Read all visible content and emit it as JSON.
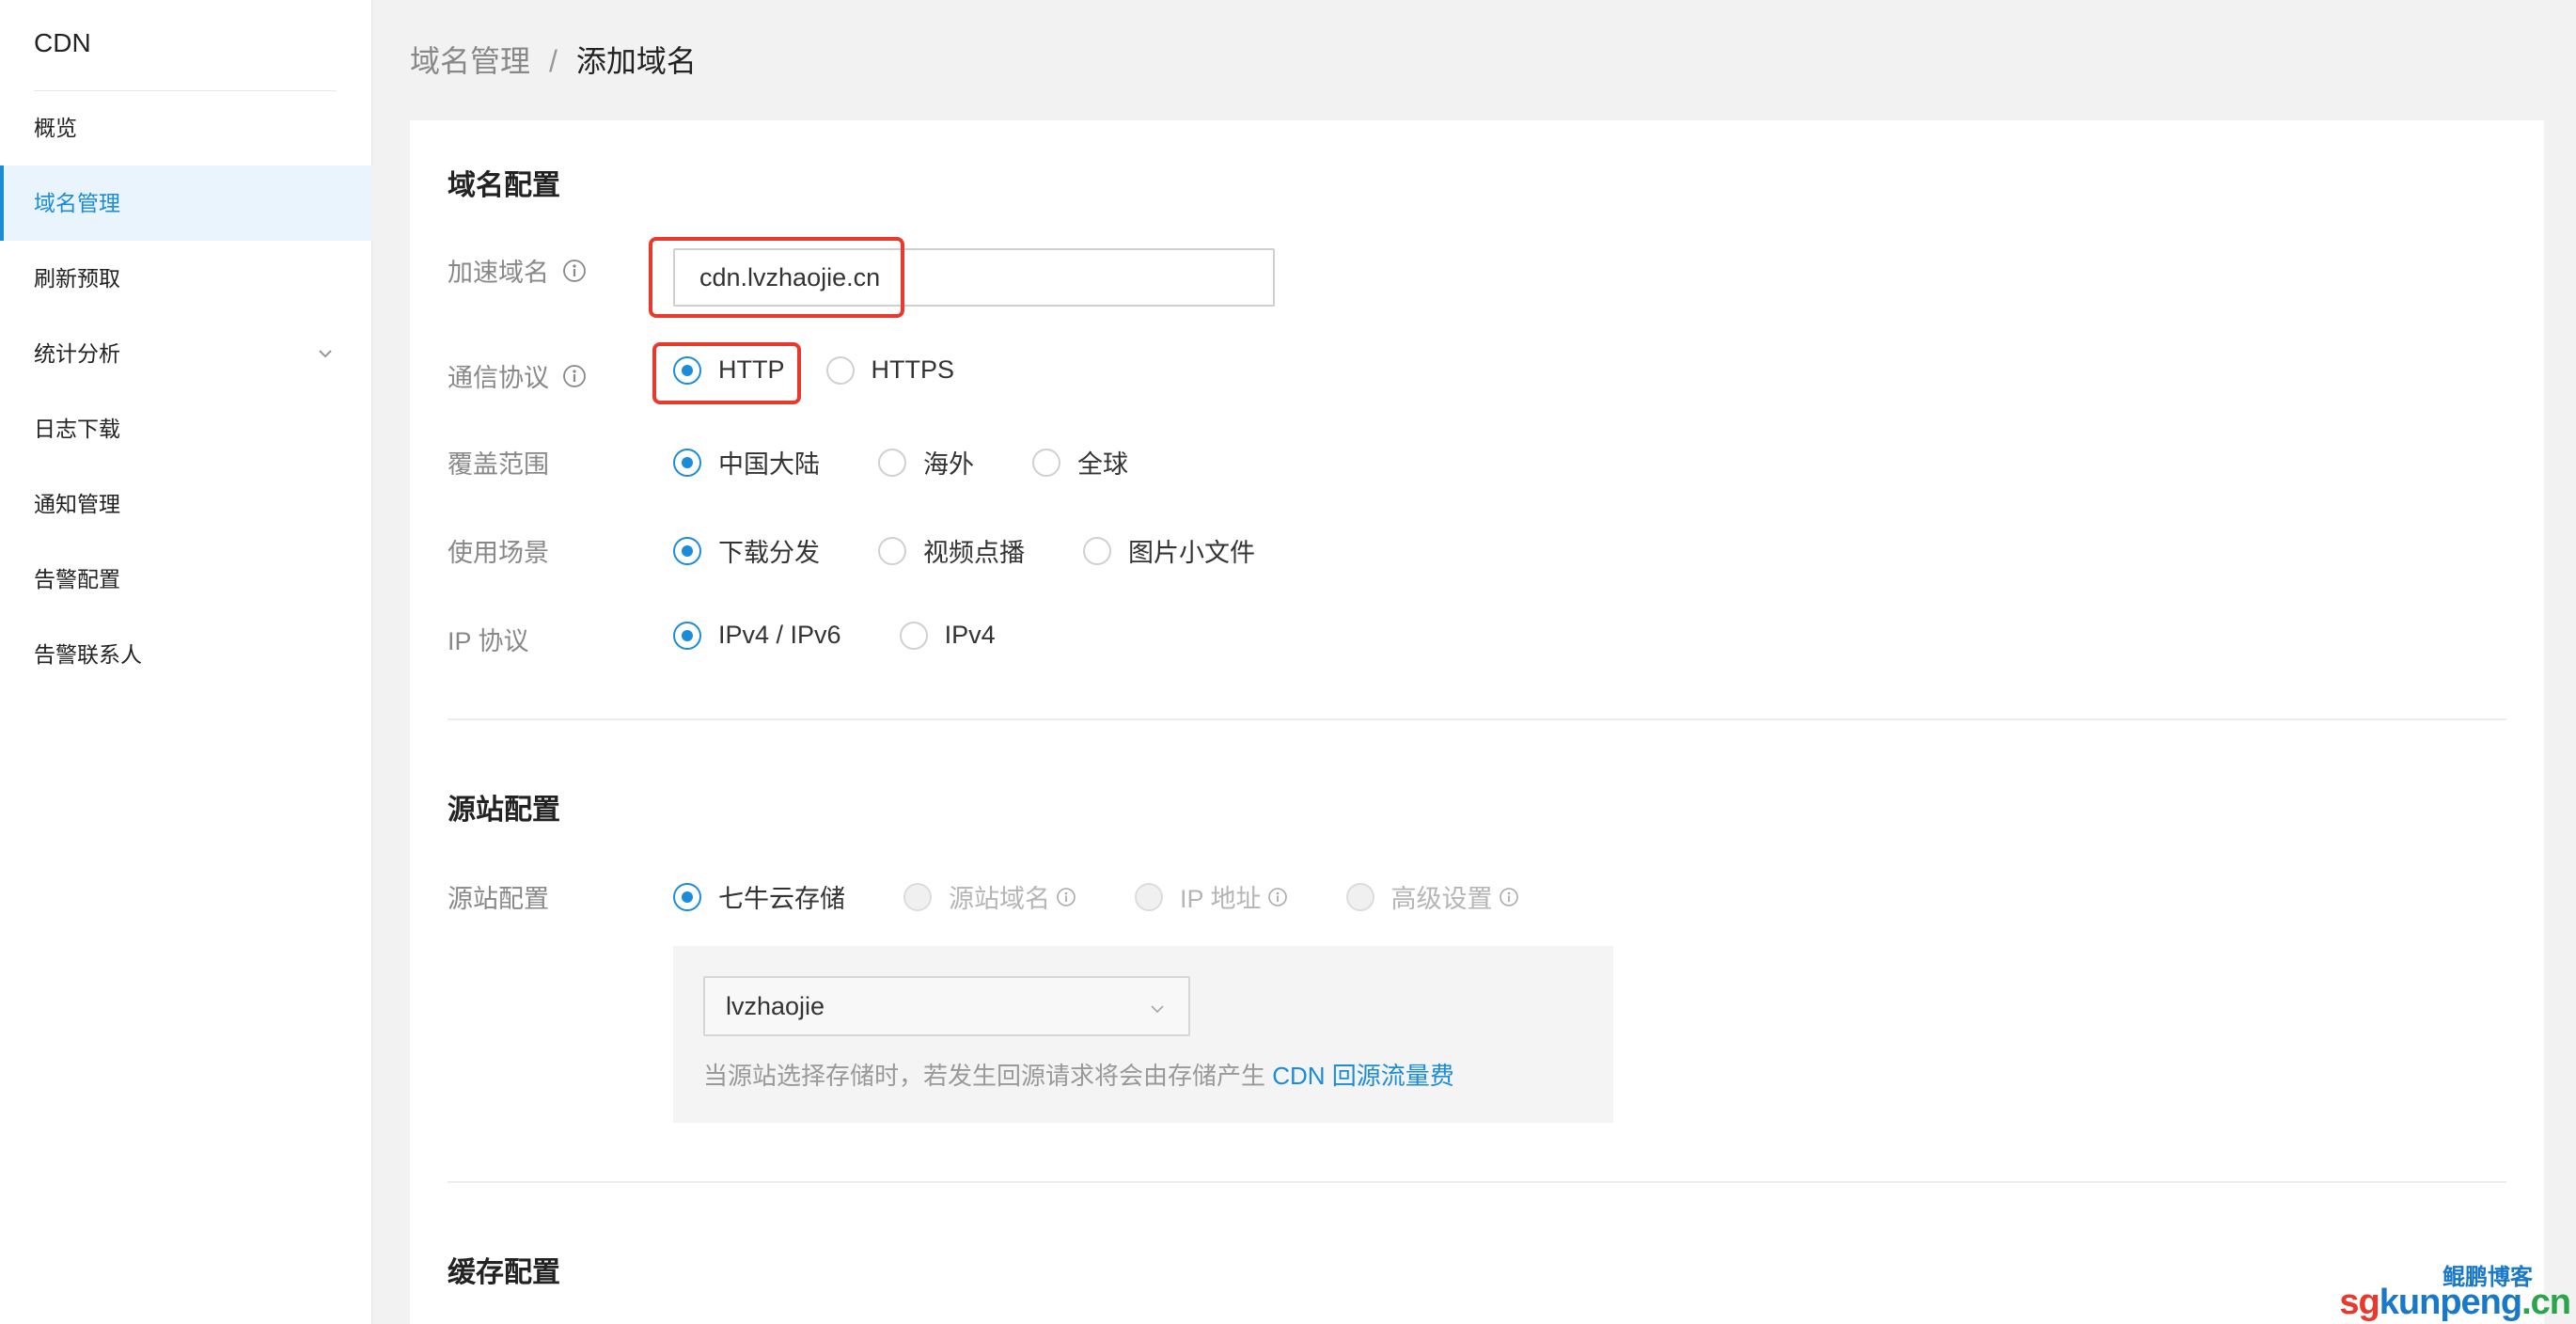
{
  "sidebar": {
    "brand": "CDN",
    "items": [
      {
        "label": "概览"
      },
      {
        "label": "域名管理"
      },
      {
        "label": "刷新预取"
      },
      {
        "label": "统计分析"
      },
      {
        "label": "日志下载"
      },
      {
        "label": "通知管理"
      },
      {
        "label": "告警配置"
      },
      {
        "label": "告警联系人"
      }
    ],
    "active_index": 1
  },
  "breadcrumb": {
    "parent": "域名管理",
    "separator": "/",
    "current": "添加域名"
  },
  "domain_config": {
    "title": "域名配置",
    "accel_domain": {
      "label": "加速域名",
      "value": "cdn.lvzhaojie.cn"
    },
    "protocol": {
      "label": "通信协议",
      "options": [
        "HTTP",
        "HTTPS"
      ],
      "selected": "HTTP"
    },
    "coverage": {
      "label": "覆盖范围",
      "options": [
        "中国大陆",
        "海外",
        "全球"
      ],
      "selected": "中国大陆"
    },
    "scenario": {
      "label": "使用场景",
      "options": [
        "下载分发",
        "视频点播",
        "图片小文件"
      ],
      "selected": "下载分发"
    },
    "ip_protocol": {
      "label": "IP 协议",
      "options": [
        "IPv4 / IPv6",
        "IPv4"
      ],
      "selected": "IPv4 / IPv6"
    }
  },
  "origin_config": {
    "title": "源站配置",
    "label": "源站配置",
    "options": [
      "七牛云存储",
      "源站域名",
      "IP 地址",
      "高级设置"
    ],
    "selected": "七牛云存储",
    "bucket": "lvzhaojie",
    "note_prefix": "当源站选择存储时，若发生回源请求将会由存储产生 ",
    "note_link": "CDN 回源流量费"
  },
  "cache_config": {
    "title": "缓存配置"
  },
  "watermark": {
    "line1": "鲲鹏博客",
    "prefix": "sg",
    "main": "kunpeng",
    "suffix": ".cn"
  },
  "colors": {
    "accent": "#1a8cd8",
    "highlight": "#e8392c"
  }
}
